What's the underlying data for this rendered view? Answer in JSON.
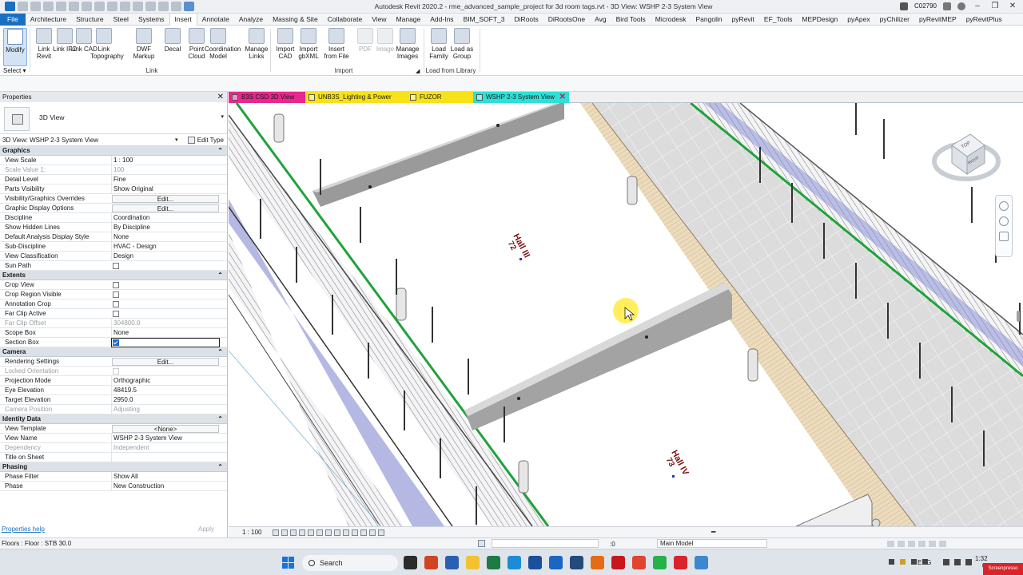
{
  "titlebar": {
    "title": "Autodesk Revit 2020.2 - rme_advanced_sample_project for 3d room tags.rvt - 3D View: WSHP 2-3 System View",
    "user": "C02790"
  },
  "ribbon_tabs": [
    "File",
    "Architecture",
    "Structure",
    "Steel",
    "Systems",
    "Insert",
    "Annotate",
    "Analyze",
    "Massing & Site",
    "Collaborate",
    "View",
    "Manage",
    "Add-Ins",
    "BIM_SOFT_3",
    "DiRoots",
    "DiRootsOne",
    "Avg",
    "Bird Tools",
    "Microdesk",
    "Pangolin",
    "pyRevit",
    "EF_Tools",
    "MEPDesign",
    "pyApex",
    "pyChilizer",
    "pyRevitMEP",
    "pyRevitPlus"
  ],
  "active_tab": "Insert",
  "ribbon": {
    "modify": "Modify",
    "select": "Select",
    "link_buttons": [
      "Link Revit",
      "Link IFC",
      "Link CAD",
      "Link Topography",
      "DWF Markup",
      "Decal",
      "Point Cloud",
      "Coordination Model",
      "Manage Links"
    ],
    "link_panel": "Link",
    "import_buttons": [
      "Import CAD",
      "Import gbXML",
      "Insert from File",
      "PDF",
      "Image",
      "Manage Images"
    ],
    "import_panel": "Import",
    "library_buttons": [
      "Load Family",
      "Load as Group"
    ],
    "library_panel": "Load from Library"
  },
  "properties": {
    "title": "Properties",
    "type_name": "3D View",
    "instance": "3D View: WSHP 2-3 System View",
    "edit_type": "Edit Type",
    "sections": [
      {
        "name": "Graphics",
        "rows": [
          {
            "k": "View Scale",
            "v": "1 : 100"
          },
          {
            "k": "Scale Value    1:",
            "v": "100",
            "dim": true
          },
          {
            "k": "Detail Level",
            "v": "Fine"
          },
          {
            "k": "Parts Visibility",
            "v": "Show Original"
          },
          {
            "k": "Visibility/Graphics Overrides",
            "v": "Edit...",
            "btn": true
          },
          {
            "k": "Graphic Display Options",
            "v": "Edit...",
            "btn": true
          },
          {
            "k": "Discipline",
            "v": "Coordination"
          },
          {
            "k": "Show Hidden Lines",
            "v": "By Discipline"
          },
          {
            "k": "Default Analysis Display Style",
            "v": "None"
          },
          {
            "k": "Sub-Discipline",
            "v": "HVAC - Design"
          },
          {
            "k": "View Classification",
            "v": "Design"
          },
          {
            "k": "Sun Path",
            "v": "",
            "cb": "off"
          }
        ]
      },
      {
        "name": "Extents",
        "rows": [
          {
            "k": "Crop View",
            "v": "",
            "cb": "off"
          },
          {
            "k": "Crop Region Visible",
            "v": "",
            "cb": "off"
          },
          {
            "k": "Annotation Crop",
            "v": "",
            "cb": "off"
          },
          {
            "k": "Far Clip Active",
            "v": "",
            "cb": "off"
          },
          {
            "k": "Far Clip Offset",
            "v": "304800.0",
            "dim": true
          },
          {
            "k": "Scope Box",
            "v": "None"
          },
          {
            "k": "Section Box",
            "v": "",
            "cb": "on",
            "boxed": true
          }
        ]
      },
      {
        "name": "Camera",
        "rows": [
          {
            "k": "Rendering Settings",
            "v": "Edit...",
            "btn": true
          },
          {
            "k": "Locked Orientation",
            "v": "",
            "cb": "dis",
            "dim": true
          },
          {
            "k": "Projection Mode",
            "v": "Orthographic"
          },
          {
            "k": "Eye Elevation",
            "v": "48419.5"
          },
          {
            "k": "Target Elevation",
            "v": "2950.0"
          },
          {
            "k": "Camera Position",
            "v": "Adjusting",
            "dim": true
          }
        ]
      },
      {
        "name": "Identity Data",
        "rows": [
          {
            "k": "View Template",
            "v": "<None>",
            "btn": true
          },
          {
            "k": "View Name",
            "v": "WSHP 2-3 System View"
          },
          {
            "k": "Dependency",
            "v": "Independent",
            "dim": true
          },
          {
            "k": "Title on Sheet",
            "v": ""
          }
        ]
      },
      {
        "name": "Phasing",
        "rows": [
          {
            "k": "Phase Filter",
            "v": "Show All"
          },
          {
            "k": "Phase",
            "v": "New Construction"
          }
        ]
      }
    ],
    "help": "Properties help",
    "apply": "Apply"
  },
  "view_tabs": [
    {
      "label": "B3S CSD 3D View",
      "color": "#e8278f"
    },
    {
      "label": "UNB3S_Lighting & Power",
      "color": "#f7e21a"
    },
    {
      "label": "FUZOR",
      "color": "#f7e21a"
    },
    {
      "label": "WSHP 2-3 System View",
      "color": "#2ee0d6",
      "active": true
    }
  ],
  "room_tags": [
    {
      "name": "Hall III",
      "number": "72"
    },
    {
      "name": "Hall IV",
      "number": "73"
    }
  ],
  "viewcube": {
    "top": "TOP",
    "right": "RIGHT"
  },
  "view_scale": "1 : 100",
  "statusbar": {
    "message": "Floors : Floor : STB 30.0",
    "zero": ":0",
    "model": "Main Model"
  },
  "taskbar": {
    "search": "Search",
    "lang": "ENG",
    "time": "1:32",
    "date": "6/",
    "watermark": "Screenpresso"
  }
}
